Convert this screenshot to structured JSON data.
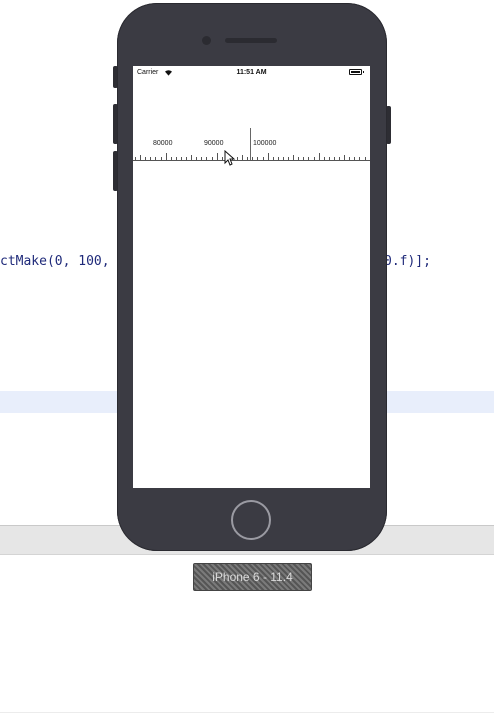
{
  "editor": {
    "code_left": "ctMake(0, 100,",
    "code_right": "0.f)];"
  },
  "simulator": {
    "device_label": "iPhone 6 - 11.4",
    "status_bar": {
      "carrier": "Carrier",
      "time": "11:51 AM",
      "wifi_icon": "wifi-icon",
      "battery_icon": "battery-icon"
    },
    "ruler": {
      "labels": [
        "80000",
        "90000",
        "100000"
      ],
      "indicator_value": 98000
    }
  },
  "icons": {
    "cursor": "cursor-icon"
  }
}
